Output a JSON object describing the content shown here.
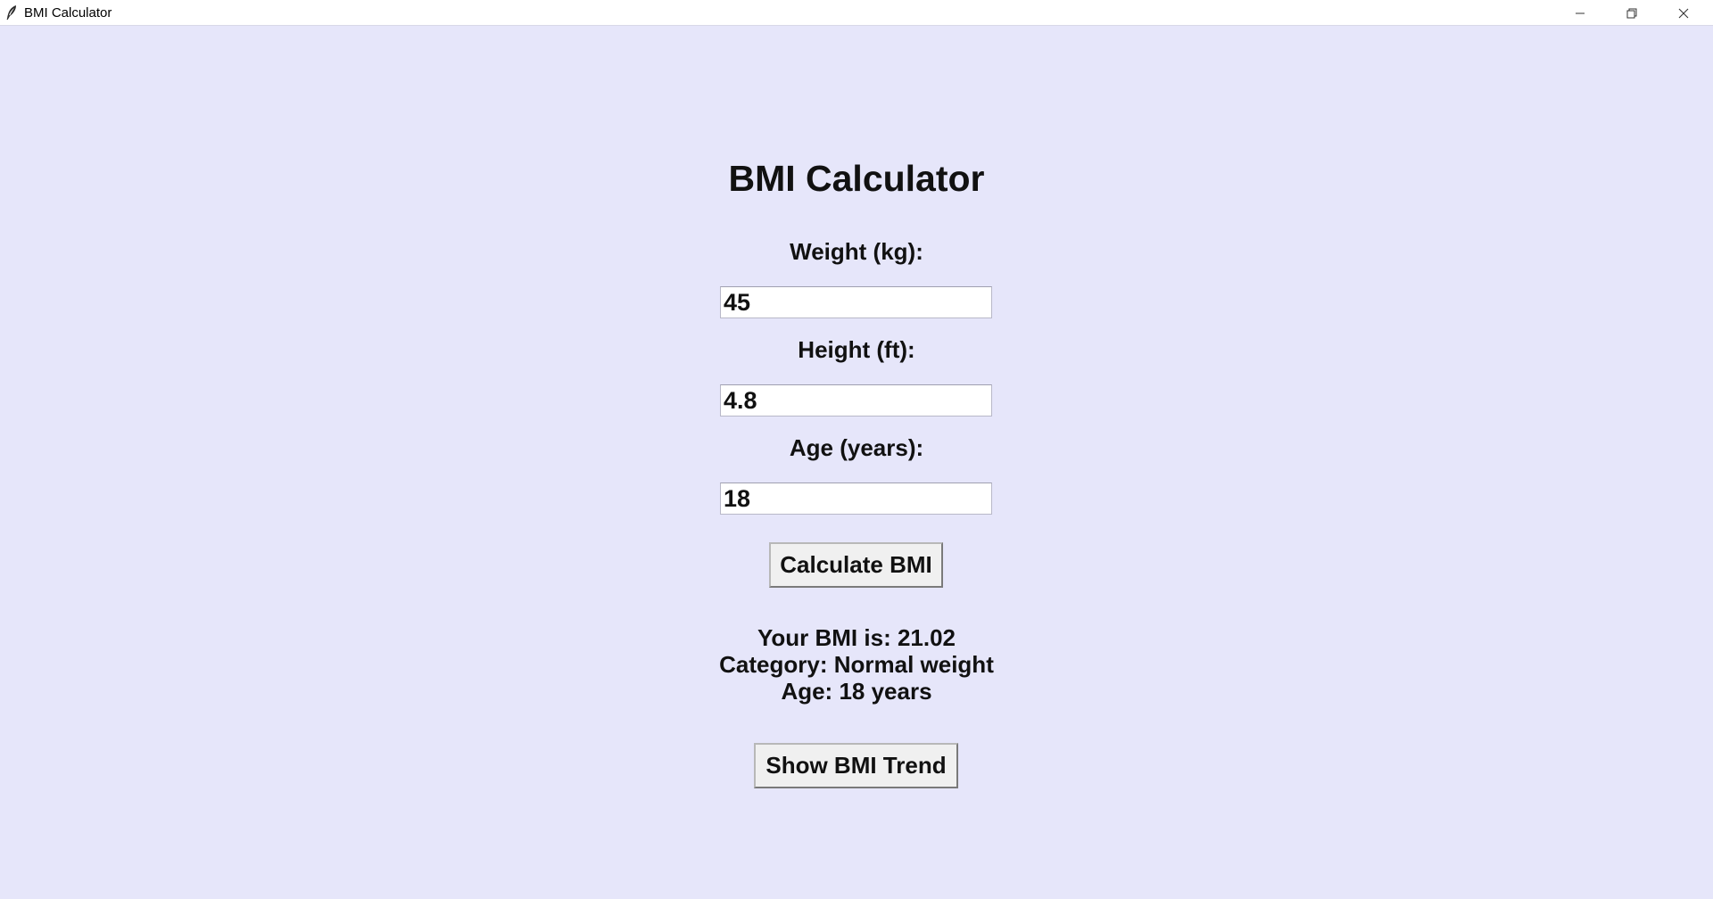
{
  "window": {
    "title": "BMI Calculator",
    "background_color": "#e6e6fa",
    "app_icon": "feather-icon"
  },
  "app": {
    "title": "BMI Calculator",
    "weight": {
      "label": "Weight (kg):",
      "value": "45"
    },
    "height": {
      "label": "Height (ft):",
      "value": "4.8"
    },
    "age": {
      "label": "Age (years):",
      "value": "18"
    },
    "calculate_button": "Calculate BMI",
    "result": {
      "bmi_line": "Your BMI is: 21.02",
      "category_line": "Category: Normal weight",
      "age_line": "Age: 18 years"
    },
    "trend_button": "Show BMI Trend"
  }
}
